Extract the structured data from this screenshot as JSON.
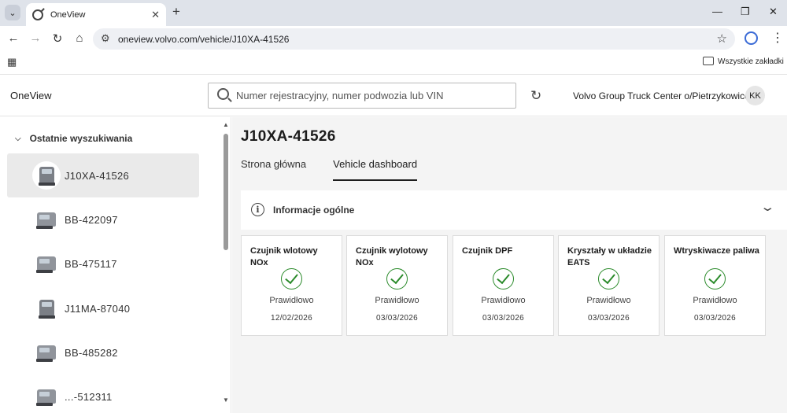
{
  "browser": {
    "tab_title": "OneView",
    "url": "oneview.volvo.com/vehicle/J10XA-41526",
    "bookmarks_label": "Wszystkie zakładki"
  },
  "header": {
    "brand": "OneView",
    "search_placeholder": "Numer rejestracyjny, numer podwozia lub VIN",
    "dealer": "Volvo Group Truck Center o/Pietrzykowice",
    "avatar_initials": "KK"
  },
  "sidebar": {
    "section_title": "Ostatnie wyszukiwania",
    "items": [
      {
        "label": "J10XA-41526",
        "active": true,
        "icon": "truck-front-icon"
      },
      {
        "label": "BB-422097",
        "active": false,
        "icon": "truck-side-icon"
      },
      {
        "label": "BB-475117",
        "active": false,
        "icon": "truck-side-icon"
      },
      {
        "label": "J11MA-87040",
        "active": false,
        "icon": "truck-front-icon"
      },
      {
        "label": "BB-485282",
        "active": false,
        "icon": "truck-side-icon"
      },
      {
        "label": "...-512311",
        "active": false,
        "icon": "truck-side-icon"
      }
    ]
  },
  "main": {
    "vehicle_title": "J10XA-41526",
    "tabs": [
      {
        "label": "Strona główna",
        "active": false
      },
      {
        "label": "Vehicle dashboard",
        "active": true
      }
    ],
    "panel_title": "Informacje ogólne",
    "cards": [
      {
        "name": "Czujnik wlotowy NOx",
        "status": "Prawidłowo",
        "date": "12/02/2026"
      },
      {
        "name": "Czujnik wylotowy NOx",
        "status": "Prawidłowo",
        "date": "03/03/2026"
      },
      {
        "name": "Czujnik DPF",
        "status": "Prawidłowo",
        "date": "03/03/2026"
      },
      {
        "name": "Kryształy w układzie EATS",
        "status": "Prawidłowo",
        "date": "03/03/2026"
      },
      {
        "name": "Wtryskiwacze paliwa",
        "status": "Prawidłowo",
        "date": "03/03/2026"
      }
    ]
  },
  "colors": {
    "ok_green": "#2a8a2a",
    "active_item_bg": "#eaeaea",
    "content_bg": "#f4f4f4"
  }
}
